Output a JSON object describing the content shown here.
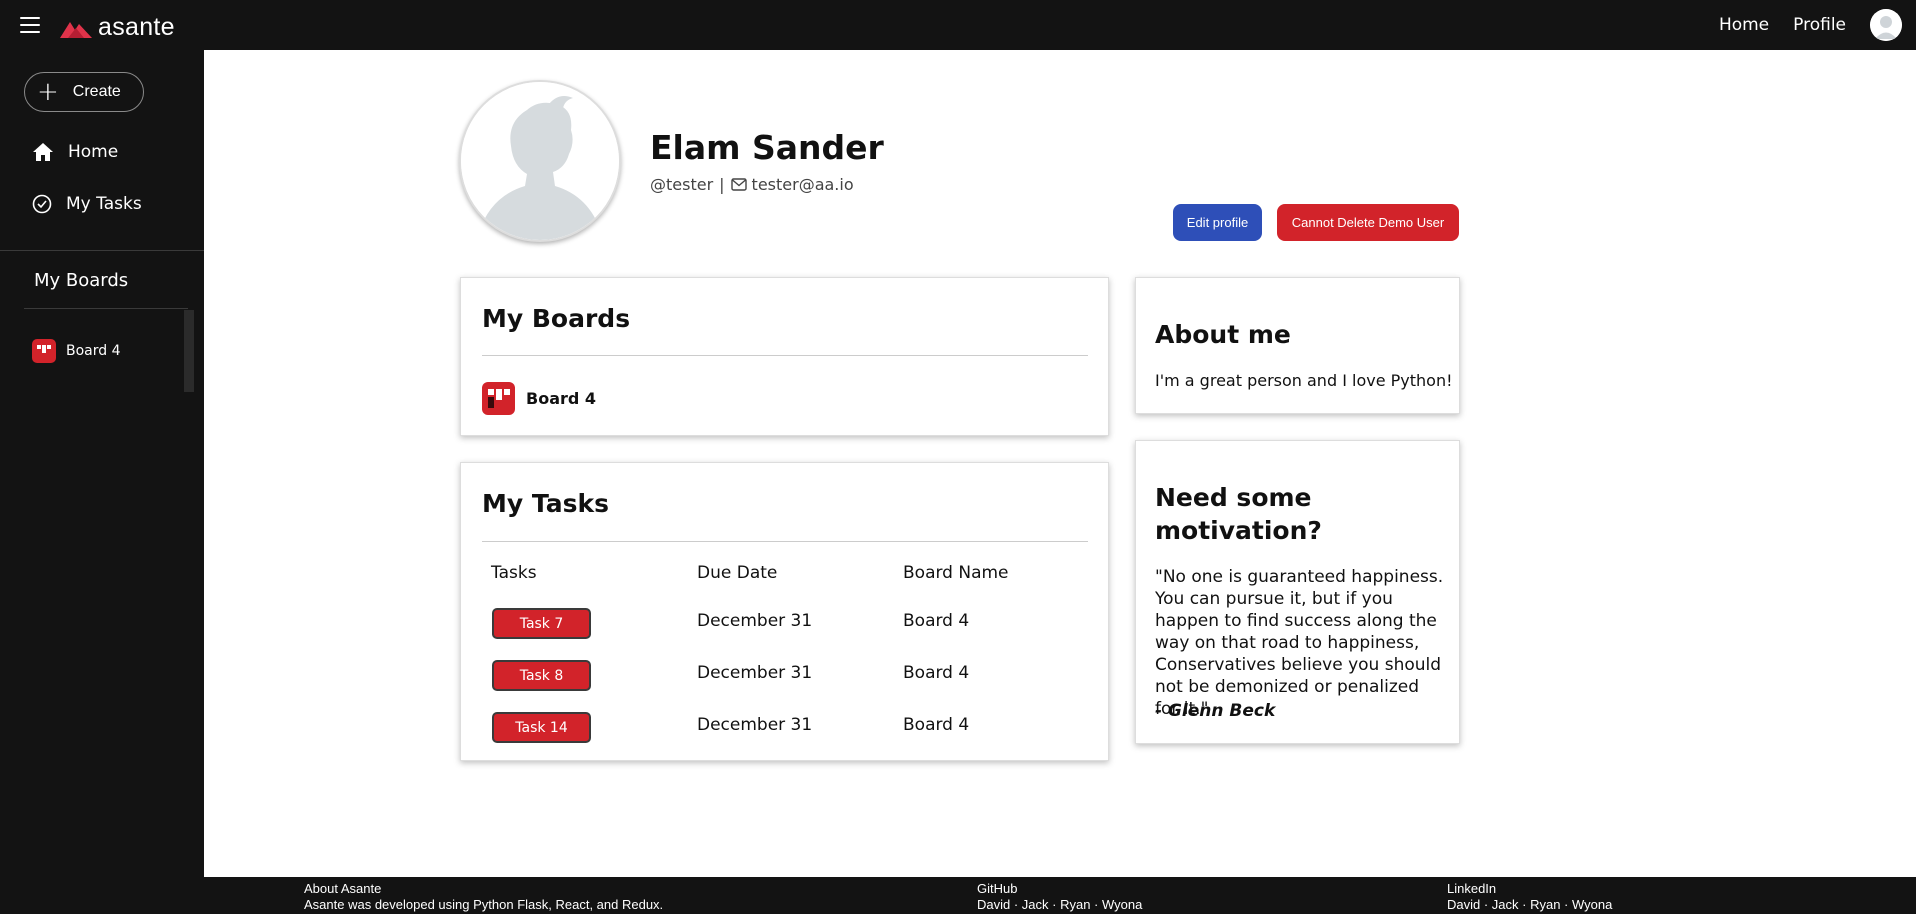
{
  "app": {
    "logo_text": "asante",
    "brand_color": "#d2232a"
  },
  "topnav": {
    "home": "Home",
    "profile": "Profile"
  },
  "sidebar": {
    "create_label": "Create",
    "items": [
      {
        "label": "Home",
        "icon": "home-icon"
      },
      {
        "label": "My Tasks",
        "icon": "check-circle-icon"
      }
    ],
    "boards_title": "My Boards",
    "boards": [
      {
        "label": "Board 4",
        "icon": "board-icon"
      }
    ]
  },
  "profile": {
    "name": "Elam Sander",
    "handle": "@tester",
    "separator": "|",
    "email": "tester@aa.io",
    "edit_label": "Edit profile",
    "delete_label": "Cannot Delete Demo User"
  },
  "boards_card": {
    "title": "My Boards",
    "boards": [
      {
        "label": "Board 4"
      }
    ]
  },
  "tasks_card": {
    "title": "My Tasks",
    "columns": [
      "Tasks",
      "Due Date",
      "Board Name"
    ],
    "rows": [
      {
        "task": "Task 7",
        "due": "December 31",
        "board": "Board 4"
      },
      {
        "task": "Task 8",
        "due": "December 31",
        "board": "Board 4"
      },
      {
        "task": "Task 14",
        "due": "December 31",
        "board": "Board 4"
      }
    ]
  },
  "about_card": {
    "title": "About me",
    "text": "I'm a great person and I love Python!"
  },
  "motivation_card": {
    "title_line1": "Need some",
    "title_line2": "motivation?",
    "quote": "\"No one is guaranteed happiness. You can pursue it, but if you happen to find success along the way on that road to happiness, Conservatives believe you should not be demonized or penalized for it.\"",
    "author": "- Glenn Beck"
  },
  "footer": {
    "about_title": "About Asante",
    "about_text": "Asante was developed using Python Flask, React, and Redux.",
    "github_title": "GitHub",
    "github_names": "David · Jack · Ryan · Wyona",
    "linkedin_title": "LinkedIn",
    "linkedin_names": "David · Jack · Ryan · Wyona"
  }
}
